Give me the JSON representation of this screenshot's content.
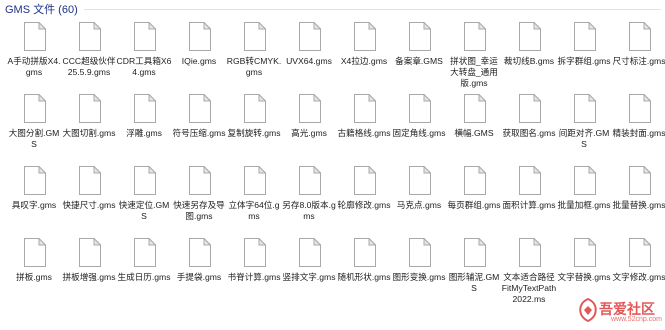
{
  "group": {
    "title": "GMS 文件 (60)"
  },
  "items": [
    {
      "label": "A手动拼版X4.gms"
    },
    {
      "label": "CCC超级伙伴25.5.9.gms"
    },
    {
      "label": "CDR工具箱X64.gms"
    },
    {
      "label": "IQie.gms"
    },
    {
      "label": "RGB转CMYK.gms"
    },
    {
      "label": "UVX64.gms"
    },
    {
      "label": "X4拉边.gms"
    },
    {
      "label": "备案章.GMS"
    },
    {
      "label": "拼状图_幸运大转盘_通用版.gms"
    },
    {
      "label": "裁切线B.gms"
    },
    {
      "label": "拆字群组.gms"
    },
    {
      "label": "尺寸标注.gms"
    },
    {
      "label": "大图分割.GMS"
    },
    {
      "label": "大图切割.gms"
    },
    {
      "label": "浮雕.gms"
    },
    {
      "label": "符号压缩.gms"
    },
    {
      "label": "复制旋转.gms"
    },
    {
      "label": "高光.gms"
    },
    {
      "label": "古籍格线.gms"
    },
    {
      "label": "固定角线.gms"
    },
    {
      "label": "横幅.GMS"
    },
    {
      "label": "获取图名.gms"
    },
    {
      "label": "间距对齐.GMS"
    },
    {
      "label": "精装封面.gms"
    },
    {
      "label": "具叹字.gms"
    },
    {
      "label": "快捷尺寸.gms"
    },
    {
      "label": "快速定位.GMS"
    },
    {
      "label": "快速另存及导图.gms"
    },
    {
      "label": "立体字64位.gms"
    },
    {
      "label": "另存8.0版本.gms"
    },
    {
      "label": "轮廓修改.gms"
    },
    {
      "label": "马克点.gms"
    },
    {
      "label": "每页群组.gms"
    },
    {
      "label": "面积计算.gms"
    },
    {
      "label": "批量加框.gms"
    },
    {
      "label": "批量替换.gms"
    },
    {
      "label": "拼板.gms"
    },
    {
      "label": "拼板增强.gms"
    },
    {
      "label": "生成日历.gms"
    },
    {
      "label": "手提袋.gms"
    },
    {
      "label": "书脊计算.gms"
    },
    {
      "label": "竖排文字.gms"
    },
    {
      "label": "随机形状.gms"
    },
    {
      "label": "图形变换.gms"
    },
    {
      "label": "图形辅泥.GMS"
    },
    {
      "label": "文本适合路径FitMyTextPath2022.ms"
    },
    {
      "label": "文字替换.gms"
    },
    {
      "label": "文字修改.gms"
    }
  ],
  "watermark": {
    "text": "吾爱社区",
    "url": "www.52cnp.com"
  },
  "colors": {
    "header": "#1e3287",
    "icon_page": "#ffffff",
    "icon_border": "#a9a9a9",
    "icon_fold": "#e6e6e6",
    "watermark": "#e03a3a"
  }
}
